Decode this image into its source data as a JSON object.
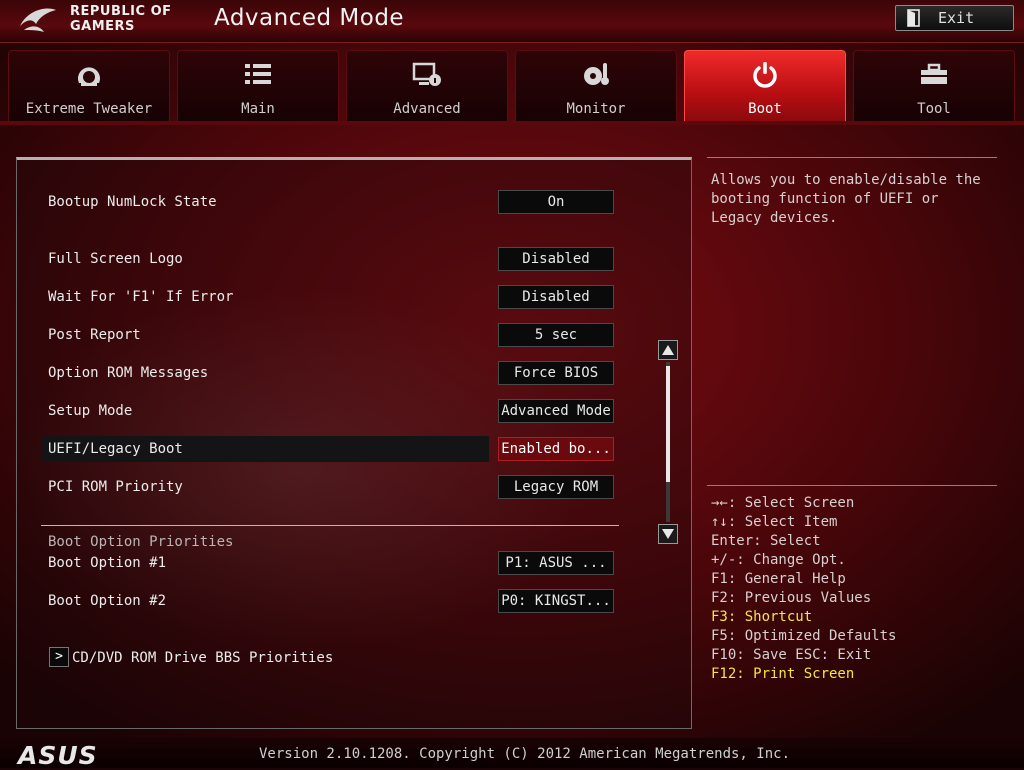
{
  "header": {
    "logo_line1": "REPUBLIC OF",
    "logo_line2": "GAMERS",
    "mode_title": "Advanced Mode",
    "exit_label": "Exit"
  },
  "tabs": [
    {
      "label": "Extreme Tweaker",
      "icon": "gauge-icon"
    },
    {
      "label": "Main",
      "icon": "list-icon"
    },
    {
      "label": "Advanced",
      "icon": "monitor-info-icon"
    },
    {
      "label": "Monitor",
      "icon": "thermometer-fan-icon"
    },
    {
      "label": "Boot",
      "icon": "power-icon",
      "active": true
    },
    {
      "label": "Tool",
      "icon": "toolbox-icon"
    }
  ],
  "settings": [
    {
      "label": "Bootup NumLock State",
      "value": "On"
    },
    {
      "label": "Full Screen Logo",
      "value": "Disabled"
    },
    {
      "label": "Wait For 'F1' If Error",
      "value": "Disabled"
    },
    {
      "label": "Post Report",
      "value": "5 sec"
    },
    {
      "label": "Option ROM Messages",
      "value": "Force BIOS"
    },
    {
      "label": "Setup Mode",
      "value": "Advanced Mode"
    },
    {
      "label": "UEFI/Legacy Boot",
      "value": "Enabled bo...",
      "selected": true
    },
    {
      "label": "PCI ROM Priority",
      "value": "Legacy ROM"
    }
  ],
  "boot_section": {
    "header": "Boot Option Priorities",
    "options": [
      {
        "label": "Boot Option #1",
        "value": "P1: ASUS  ..."
      },
      {
        "label": "Boot Option #2",
        "value": "P0: KINGST..."
      }
    ],
    "submenu_arrow": ">",
    "submenu_label": "CD/DVD ROM Drive BBS Priorities"
  },
  "help": {
    "description": "Allows you to enable/disable  the booting function of UEFI or Legacy devices."
  },
  "keys": [
    {
      "text": "→←: Select Screen",
      "highlight": false
    },
    {
      "text": "↑↓: Select Item",
      "highlight": false
    },
    {
      "text": "Enter: Select",
      "highlight": false
    },
    {
      "text": "+/-: Change Opt.",
      "highlight": false
    },
    {
      "text": "F1: General Help",
      "highlight": false
    },
    {
      "text": "F2: Previous Values",
      "highlight": false
    },
    {
      "text": "F3: Shortcut",
      "highlight": true
    },
    {
      "text": "F5: Optimized Defaults",
      "highlight": false
    },
    {
      "text": "F10: Save  ESC: Exit",
      "highlight": false
    },
    {
      "text": "F12: Print Screen",
      "highlight": true
    }
  ],
  "footer": {
    "brand": "ASUS",
    "version_text": "Version 2.10.1208. Copyright (C) 2012 American Megatrends, Inc."
  },
  "colors": {
    "accent_red": "#e0181c",
    "highlight_yellow": "#f5e640"
  }
}
